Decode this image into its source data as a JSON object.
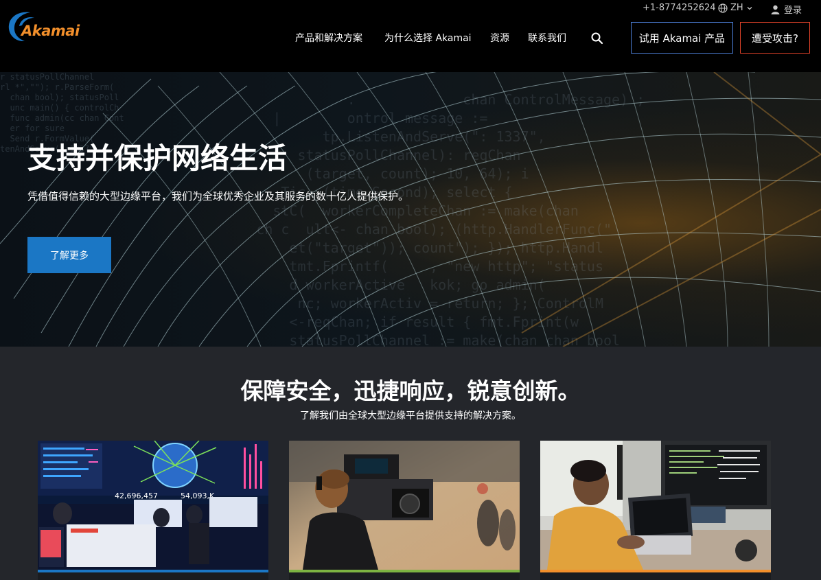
{
  "header": {
    "logo_text": "Akamai",
    "phone": "+1-8774252624",
    "language": "ZH",
    "login": "登录",
    "nav": [
      "产品和解决方案",
      "为什么选择 Akamai",
      "资源",
      "联系我们"
    ],
    "try_button": "试用 Akamai 产品",
    "attack_button": "遭受攻击?"
  },
  "hero": {
    "title": "支持并保护网络生活",
    "subtitle": "凭借值得信赖的大型边缘平台，我们为全球优秀企业及其服务的数十亿人提供保护。",
    "button": "了解更多"
  },
  "section": {
    "title": "保障安全，迅捷响应，锐意创新。",
    "subtitle": "了解我们由全球大型边缘平台提供支持的解决方案。"
  },
  "cards": [
    {
      "accent": "#1b77c5"
    },
    {
      "accent": "#7cb342"
    },
    {
      "accent": "#f28f2b"
    }
  ],
  "card1_screen": {
    "left_value": "42,696,457",
    "right_value": "54,093,K"
  },
  "colors": {
    "brand_orange": "#f28f2b",
    "brand_blue": "#1b77c5",
    "attack_red": "#e2432a"
  }
}
